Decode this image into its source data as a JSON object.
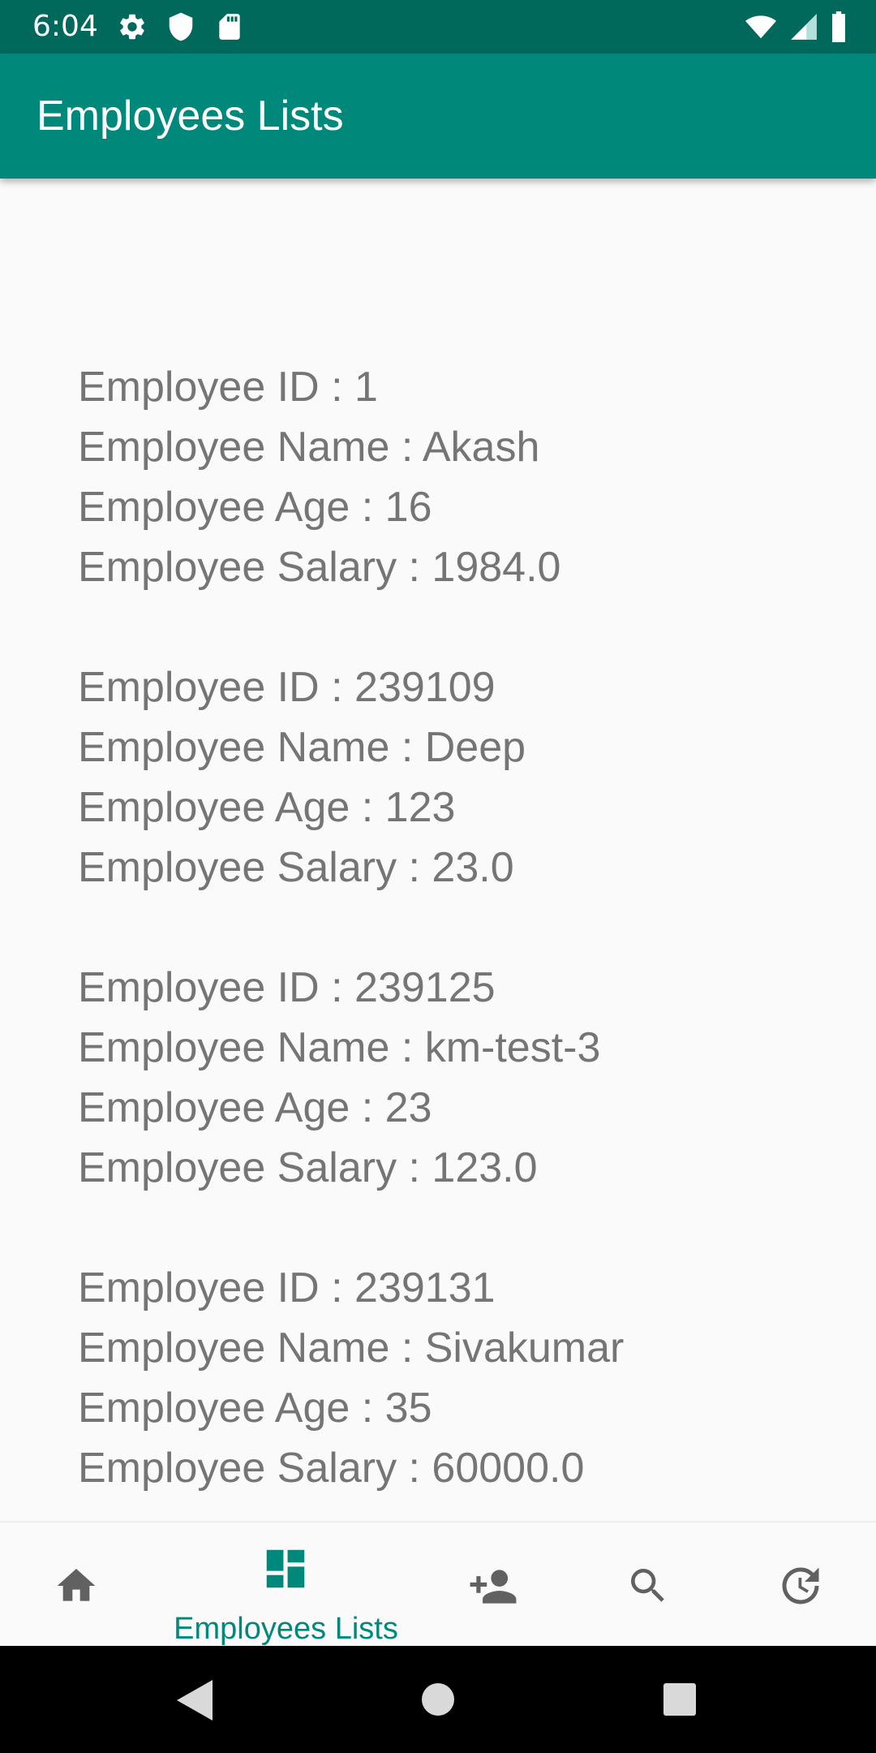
{
  "status_bar": {
    "time": "6:04",
    "left_icons": [
      "gear-icon",
      "shield-icon",
      "sd-card-icon"
    ],
    "right_icons": [
      "wifi-icon",
      "signal-icon",
      "battery-icon"
    ]
  },
  "app_bar": {
    "title": "Employees Lists"
  },
  "employees": [
    {
      "id_line": "Employee ID : 1",
      "name_line": "Employee Name : Akash",
      "age_line": "Employee Age : 16",
      "salary_line": "Employee Salary : 1984.0"
    },
    {
      "id_line": "Employee ID : 239109",
      "name_line": "Employee Name : Deep",
      "age_line": "Employee Age : 123",
      "salary_line": "Employee Salary : 23.0"
    },
    {
      "id_line": "Employee ID : 239125",
      "name_line": "Employee Name : km-test-3",
      "age_line": "Employee Age : 23",
      "salary_line": "Employee Salary : 123.0"
    },
    {
      "id_line": "Employee ID : 239131",
      "name_line": "Employee Name : Sivakumar",
      "age_line": "Employee Age : 35",
      "salary_line": "Employee Salary : 60000.0"
    }
  ],
  "bottom_nav": {
    "items": [
      {
        "icon": "home-icon",
        "label": ""
      },
      {
        "icon": "dashboard-icon",
        "label": "Employees Lists",
        "active": true
      },
      {
        "icon": "person-add-icon",
        "label": ""
      },
      {
        "icon": "search-icon",
        "label": ""
      },
      {
        "icon": "restore-icon",
        "label": ""
      }
    ],
    "active_color": "#00897b",
    "inactive_color": "#616161"
  },
  "colors": {
    "status_bar": "#00695c",
    "app_bar": "#00897b",
    "text": "#757575",
    "background": "#fafafa"
  },
  "system_nav": {
    "buttons": [
      "back-icon",
      "home-circle-icon",
      "recents-icon"
    ]
  }
}
